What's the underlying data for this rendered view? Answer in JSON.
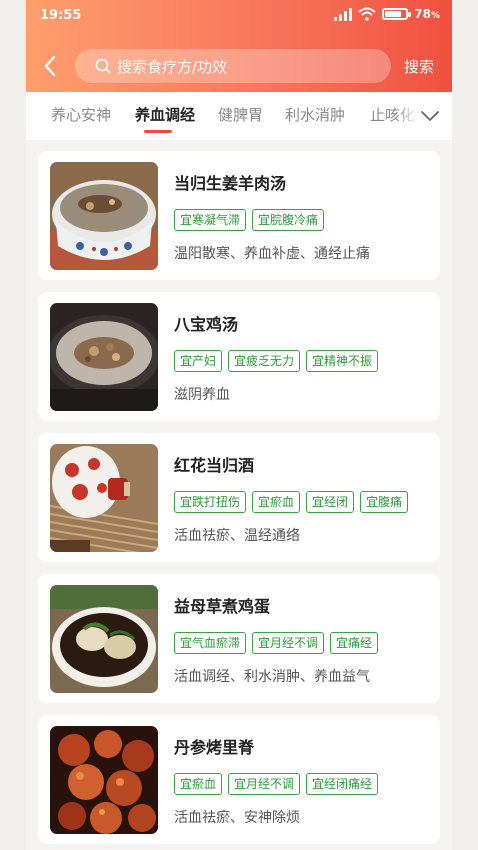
{
  "status_bar": {
    "time": "19:55",
    "battery": "78",
    "battery_unit": "%",
    "battery_level": 0.78
  },
  "search": {
    "placeholder": "搜索食疗方/功效",
    "button_label": "搜索"
  },
  "tabs": [
    {
      "label": "养心安神",
      "active": false
    },
    {
      "label": "养血调经",
      "active": true
    },
    {
      "label": "健脾胃",
      "active": false
    },
    {
      "label": "利水消肿",
      "active": false
    },
    {
      "label": "止咳化",
      "active": false
    }
  ],
  "recipes": [
    {
      "title": "当归生姜羊肉汤",
      "tags": [
        "宜寒凝气滞",
        "宜脘腹冷痛"
      ],
      "desc": "温阳散寒、养血补虚、通经止痛",
      "image": "mutton-soup-bowl"
    },
    {
      "title": "八宝鸡汤",
      "tags": [
        "宜产妇",
        "宜疲乏无力",
        "宜精神不振"
      ],
      "desc": "滋阴养血",
      "image": "chicken-soup-pot"
    },
    {
      "title": "红花当归酒",
      "tags": [
        "宜跌打扭伤",
        "宜瘀血",
        "宜经闭",
        "宜腹痛"
      ],
      "desc": "活血祛瘀、温经通络",
      "image": "wine-jar"
    },
    {
      "title": "益母草煮鸡蛋",
      "tags": [
        "宜气血瘀滞",
        "宜月经不调",
        "宜痛经"
      ],
      "desc": "活血调经、利水消肿、养血益气",
      "image": "herbal-eggs"
    },
    {
      "title": "丹参烤里脊",
      "tags": [
        "宜瘀血",
        "宜月经不调",
        "宜经闭痛经"
      ],
      "desc": "活血祛瘀、安神除烦",
      "image": "roast-pork"
    }
  ],
  "colors": {
    "accent": "#ef4b3a",
    "tag_green": "#2e9a3a",
    "header_start": "#ff9e6c",
    "header_end": "#f0503f"
  }
}
